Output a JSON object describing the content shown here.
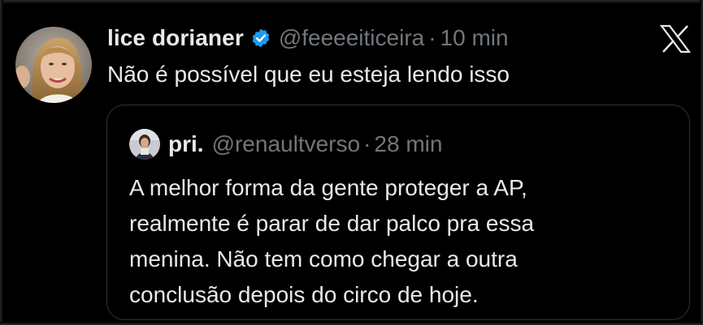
{
  "tweet": {
    "author": {
      "display_name": "lice dorianer",
      "handle": "@feeeeiticeira",
      "verified": true,
      "avatar": "woman-portrait"
    },
    "separator": "·",
    "time": "10 min",
    "text": "Não é possível que eu esteja lendo isso",
    "platform_icon": "x-logo-icon"
  },
  "quoted_tweet": {
    "author": {
      "display_name": "pri.",
      "handle": "@renaultverso",
      "avatar": "small-portrait"
    },
    "separator": "·",
    "time": "28 min",
    "text_lines": [
      "A melhor forma da gente proteger a AP,",
      "realmente é parar de dar palco pra essa",
      "menina. Não tem como chegar a outra",
      "conclusão depois do circo de hoje."
    ]
  },
  "colors": {
    "background": "#000000",
    "primary_text": "#e7e9ea",
    "secondary_text": "#71767b",
    "border": "#2f3336",
    "verified_badge": "#1d9bf0"
  }
}
